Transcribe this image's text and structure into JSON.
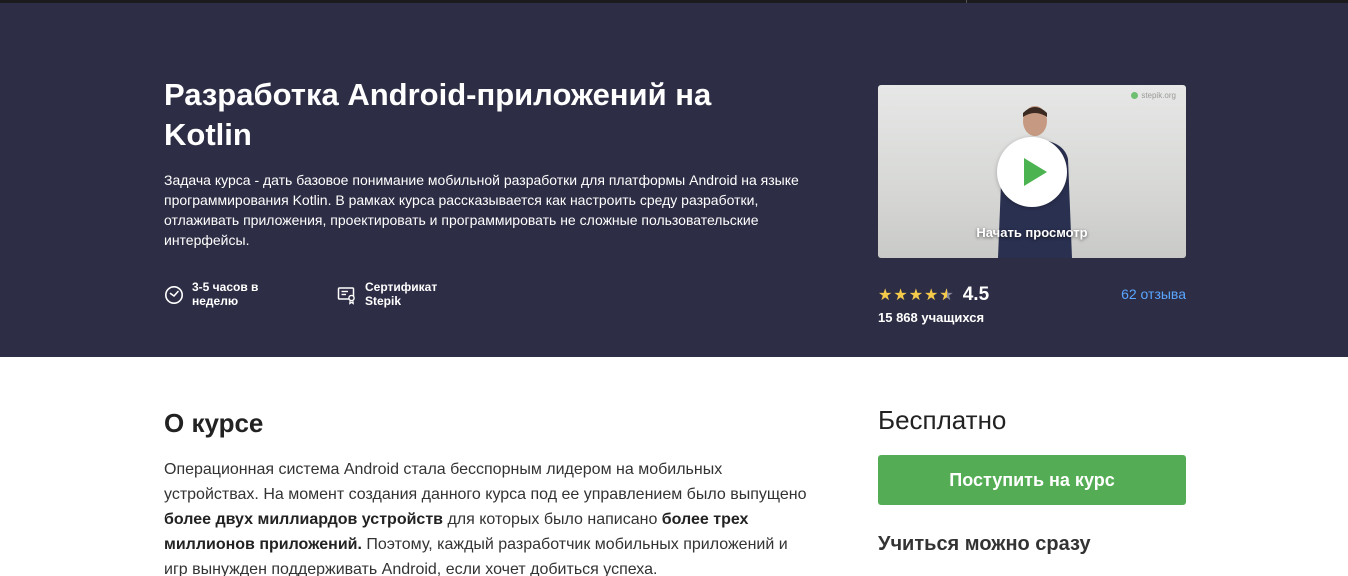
{
  "hero": {
    "title": "Разработка Android-приложений на Kotlin",
    "description": "Задача курса - дать базовое понимание мобильной разработки для платформы Android на языке программирования Kotlin. В рамках курса рассказывается как настроить среду разработки, отлаживать приложения, проектировать и программировать не сложные пользовательские интерфейсы.",
    "features": [
      {
        "icon": "clock-icon",
        "label": "3-5 часов в неделю"
      },
      {
        "icon": "certificate-icon",
        "label": "Сертификат Stepik"
      }
    ],
    "video": {
      "brand": "stepik.org",
      "play_label": "Начать просмотр"
    },
    "rating": {
      "value": "4.5",
      "stars": 4.5,
      "reviews": "62 отзыва",
      "learners": "15 868 учащихся"
    }
  },
  "about": {
    "title": "О курсе",
    "text_parts": [
      "Операционная система Android стала бесспорным лидером на мобильных устройствах. На момент создания данного курса под ее управлением было выпущено ",
      "более двух миллиардов устройств",
      " для которых было написано ",
      "более трех миллионов приложений.",
      " Поэтому, каждый разработчик мобильных приложений и игр вынужден поддерживать Android, если хочет добиться успеха."
    ]
  },
  "sidebar": {
    "price": "Бесплатно",
    "enroll_label": "Поступить на курс",
    "start_label": "Учиться можно сразу"
  },
  "colors": {
    "hero_bg": "#2d2e45",
    "accent_green": "#54ad54",
    "link_blue": "#5aa5ff",
    "star": "#f5c94a"
  }
}
